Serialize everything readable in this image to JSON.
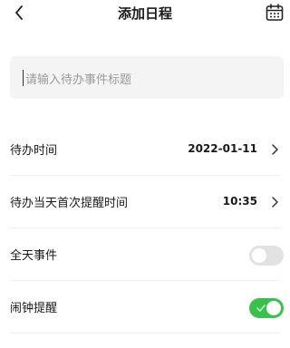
{
  "header": {
    "title": "添加日程",
    "back_icon": "back-chevron-icon",
    "calendar_icon": "calendar-icon"
  },
  "title_input": {
    "placeholder": "请输入待办事件标题",
    "value": ""
  },
  "settings": {
    "todo_time": {
      "label": "待办时间",
      "value": "2022-01-11"
    },
    "first_reminder": {
      "label": "待办当天首次提醒时间",
      "value": "10:35"
    },
    "all_day": {
      "label": "全天事件",
      "enabled": false
    },
    "alarm": {
      "label": "闹钟提醒",
      "enabled": true
    }
  },
  "colors": {
    "toggle_on": "#3bbf4d",
    "toggle_off": "#e2e2e2",
    "input_bg": "#f4f4f4",
    "placeholder": "#9a9a9a"
  }
}
